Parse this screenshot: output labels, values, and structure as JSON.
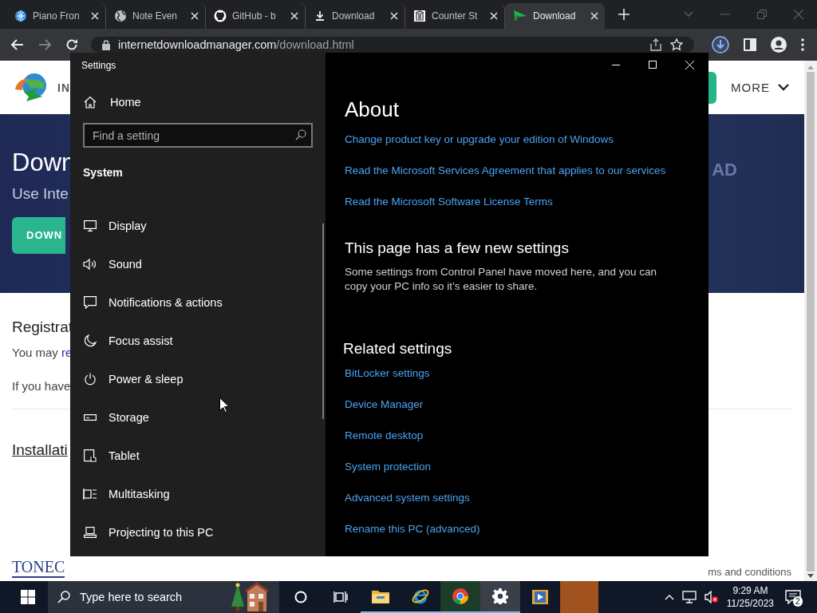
{
  "browser": {
    "tabs": [
      {
        "title": "Piano Fron",
        "kind": "globe-blue",
        "selected": false
      },
      {
        "title": "Note Even",
        "kind": "globe",
        "selected": false
      },
      {
        "title": "GitHub - b",
        "kind": "github",
        "selected": false
      },
      {
        "title": "Download",
        "kind": "download",
        "selected": false
      },
      {
        "title": "Counter St",
        "kind": "building",
        "selected": false
      },
      {
        "title": "Download",
        "kind": "arrow-green",
        "selected": true
      }
    ],
    "url": {
      "host": "internetdownloadmanager.com",
      "path": "/download.html"
    }
  },
  "webpage": {
    "brand": "IN",
    "more": "MORE",
    "banner_title": "Down",
    "banner_subtitle": "Use Inte",
    "banner_button": "DOWN",
    "banner_faint": "AD",
    "registration_heading": "Registrat",
    "registration_text": "You may",
    "registration_link": "re",
    "registration_note": "If you have",
    "installation_heading": "Installati",
    "footer_logo": "TONEC",
    "footer_link": "ms and conditions"
  },
  "settings": {
    "title": "Settings",
    "home": "Home",
    "search": {
      "placeholder": "Find a setting"
    },
    "section": "System",
    "nav": [
      {
        "label": "Display",
        "kind": "display"
      },
      {
        "label": "Sound",
        "kind": "sound"
      },
      {
        "label": "Notifications & actions",
        "kind": "notifications"
      },
      {
        "label": "Focus assist",
        "kind": "focus"
      },
      {
        "label": "Power & sleep",
        "kind": "power"
      },
      {
        "label": "Storage",
        "kind": "storage"
      },
      {
        "label": "Tablet",
        "kind": "tablet"
      },
      {
        "label": "Multitasking",
        "kind": "multitasking"
      },
      {
        "label": "Projecting to this PC",
        "kind": "projecting"
      }
    ],
    "heading": "About",
    "links": [
      "Change product key or upgrade your edition of Windows",
      "Read the Microsoft Services Agreement that applies to our services",
      "Read the Microsoft Software License Terms"
    ],
    "new_heading": "This page has a few new settings",
    "new_text": "Some settings from Control Panel have moved here, and you can copy your PC info so it’s easier to share.",
    "related_heading": "Related settings",
    "related_links": [
      "BitLocker settings",
      "Device Manager",
      "Remote desktop",
      "System protection",
      "Advanced system settings",
      "Rename this PC (advanced)"
    ]
  },
  "taskbar": {
    "search_placeholder": "Type here to search",
    "apps": [
      {
        "kind": "cortana",
        "running": false,
        "selected": false
      },
      {
        "kind": "taskview",
        "running": false,
        "selected": false
      },
      {
        "kind": "folder",
        "running": true,
        "selected": false
      },
      {
        "kind": "ie",
        "running": true,
        "selected": false
      },
      {
        "kind": "chrome",
        "running": true,
        "selected": false
      },
      {
        "kind": "settings",
        "running": true,
        "selected": true
      },
      {
        "kind": "media",
        "running": false,
        "selected": false
      },
      {
        "kind": "tile",
        "running": false,
        "selected": false
      }
    ],
    "time": "9:29 AM",
    "date": "11/25/2023",
    "notifications": "2"
  }
}
